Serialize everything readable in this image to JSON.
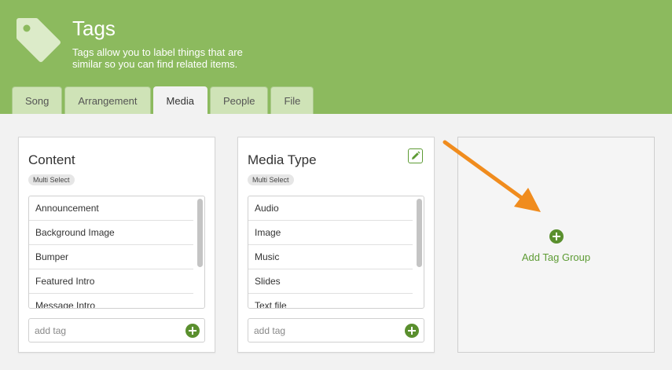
{
  "header": {
    "title": "Tags",
    "subtitle": "Tags allow you to label things that are similar so you can find related items.",
    "logo_icon": "tag-icon"
  },
  "tabs": [
    {
      "label": "Song",
      "active": false
    },
    {
      "label": "Arrangement",
      "active": false
    },
    {
      "label": "Media",
      "active": true
    },
    {
      "label": "People",
      "active": false
    },
    {
      "label": "File",
      "active": false
    }
  ],
  "groups": [
    {
      "title": "Content",
      "badge": "Multi Select",
      "items": [
        "Announcement",
        "Background Image",
        "Bumper",
        "Featured Intro",
        "Message Intro"
      ],
      "add_placeholder": "add tag",
      "editable": false
    },
    {
      "title": "Media Type",
      "badge": "Multi Select",
      "items": [
        "Audio",
        "Image",
        "Music",
        "Slides",
        "Text file"
      ],
      "add_placeholder": "add tag",
      "editable": true
    }
  ],
  "add_group": {
    "label": "Add Tag Group"
  },
  "colors": {
    "header_bg": "#8cba5e",
    "accent_green": "#5a8f2e",
    "annotation_arrow": "#f08c1e"
  }
}
